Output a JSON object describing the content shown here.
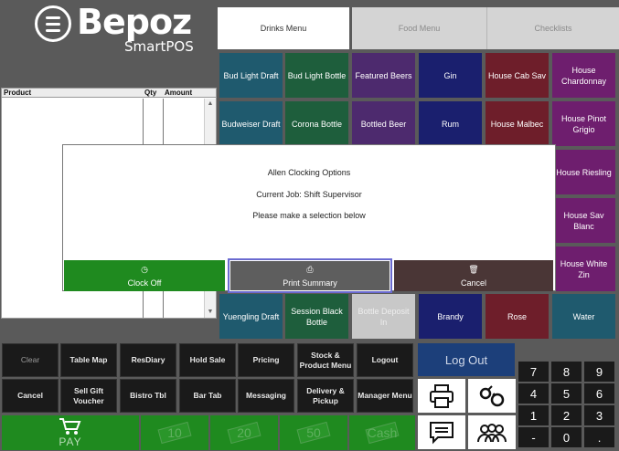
{
  "brand": {
    "name": "Bepoz",
    "sub": "SmartPOS"
  },
  "tabs": [
    {
      "label": "Drinks Menu",
      "active": true
    },
    {
      "label": "Food Menu",
      "active": false
    },
    {
      "label": "Checklists",
      "active": false
    }
  ],
  "order": {
    "col_product": "Product",
    "col_qty": "Qty",
    "col_amount": "Amount"
  },
  "menu": {
    "row1": [
      "Bud Light Draft",
      "Bud Light Bottle",
      "Featured Beers",
      "Gin",
      "House Cab Sav",
      "House Chardonnay"
    ],
    "row2": [
      "Budweiser Draft",
      "Corona Bottle",
      "Bottled Beer",
      "Rum",
      "House Malbec",
      "House Pinot Grigio"
    ],
    "right_col": [
      "House Riesling",
      "House Sav Blanc",
      "House White Zin"
    ],
    "row6": [
      "Yuengling Draft",
      "Session Black Bottle",
      "Bottle Deposit In",
      "Brandy",
      "Rose",
      "Water"
    ]
  },
  "modal": {
    "title": "Allen Clocking Options",
    "job": "Current Job: Shift Supervisor",
    "prompt": "Please make a selection below",
    "clock_off": "Clock Off",
    "print_summary": "Print Summary",
    "cancel": "Cancel"
  },
  "functions": {
    "row1": [
      "Clear",
      "Table Map",
      "ResDiary",
      "Hold Sale",
      "Pricing",
      "Stock & Product Menu",
      "Logout"
    ],
    "row2": [
      "Cancel",
      "Sell Gift Voucher",
      "Bistro Tbl",
      "Bar Tab",
      "Messaging",
      "Delivery & Pickup",
      "Manager Menu"
    ]
  },
  "payment": {
    "pay": "PAY",
    "v10": "10",
    "v20": "20",
    "v50": "50",
    "cash": "Cash"
  },
  "logout_label": "Log Out",
  "numpad": [
    "7",
    "8",
    "9",
    "4",
    "5",
    "6",
    "1",
    "2",
    "3",
    "-",
    "0",
    "."
  ],
  "colors": {
    "green": "#1f8a1f",
    "teal": "#1f5a6e",
    "darkgreen": "#1e5e3c",
    "purple": "#4d2a6e",
    "navy": "#1a1f6e",
    "maroon": "#6e1e2a",
    "violet": "#6e1e6e",
    "accent_border": "#6a6ad0"
  }
}
